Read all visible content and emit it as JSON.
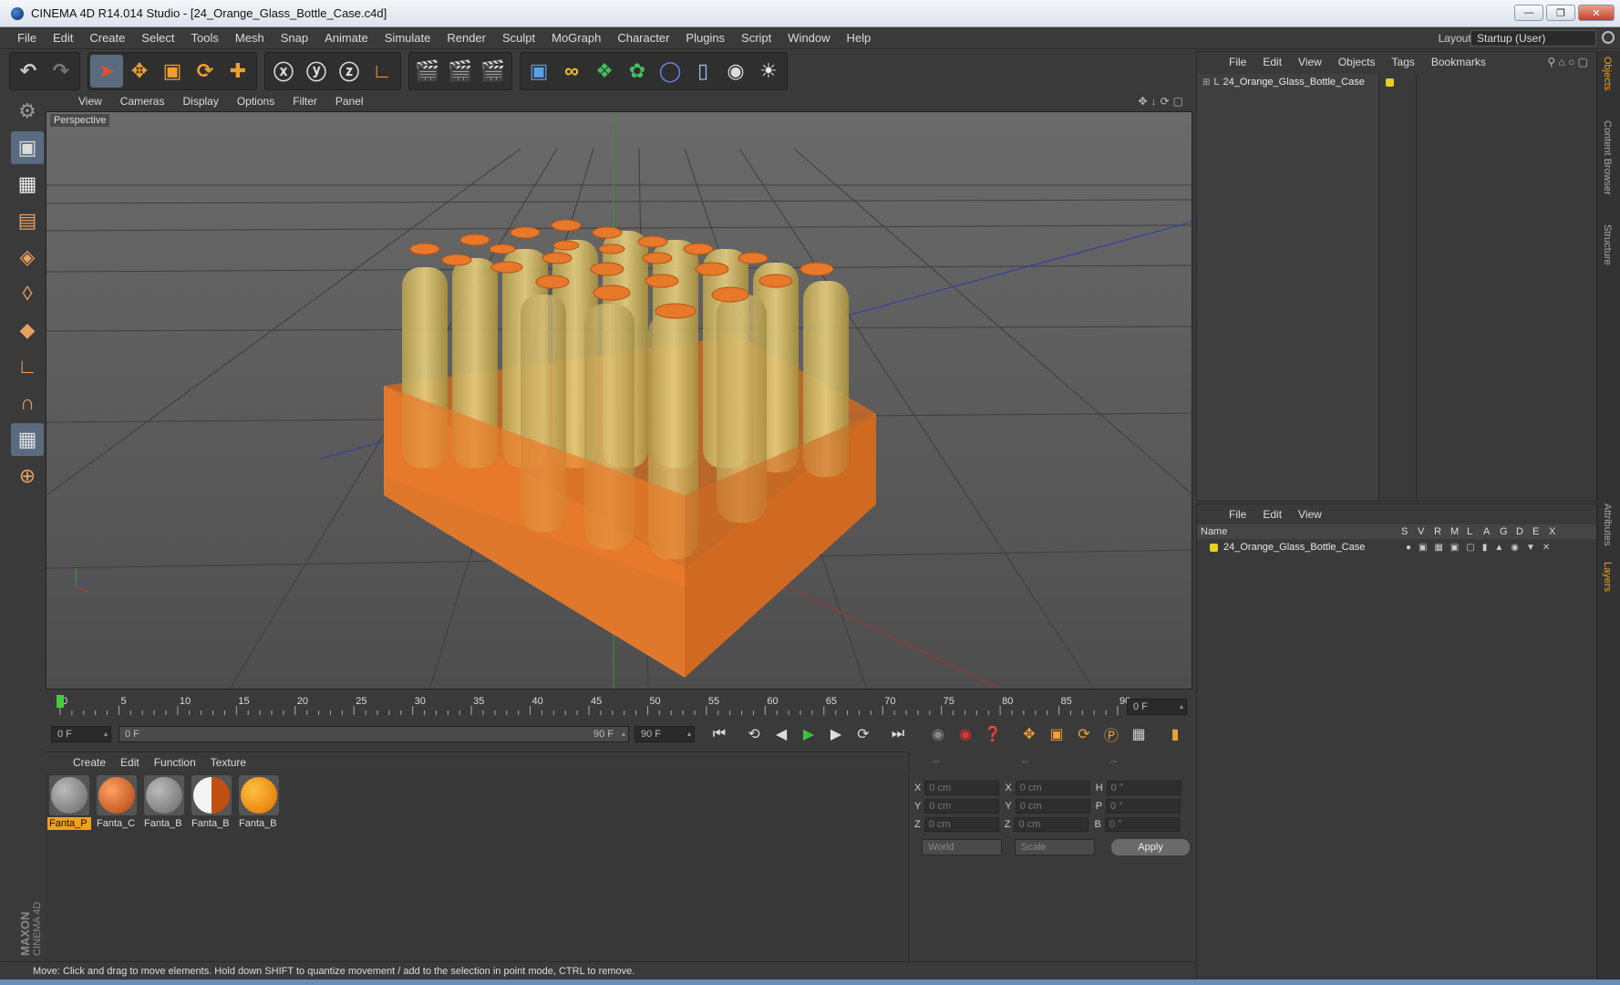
{
  "window": {
    "title": "CINEMA 4D R14.014 Studio - [24_Orange_Glass_Bottle_Case.c4d]"
  },
  "menu": [
    "File",
    "Edit",
    "Create",
    "Select",
    "Tools",
    "Mesh",
    "Snap",
    "Animate",
    "Simulate",
    "Render",
    "Sculpt",
    "MoGraph",
    "Character",
    "Plugins",
    "Script",
    "Window",
    "Help"
  ],
  "layout": {
    "label": "Layout:",
    "value": "Startup (User)"
  },
  "viewport": {
    "menu": [
      "View",
      "Cameras",
      "Display",
      "Options",
      "Filter",
      "Panel"
    ],
    "label": "Perspective"
  },
  "timeline": {
    "ticks": [
      "0",
      "5",
      "10",
      "15",
      "20",
      "25",
      "30",
      "35",
      "40",
      "45",
      "50",
      "55",
      "60",
      "65",
      "70",
      "75",
      "80",
      "85",
      "90"
    ],
    "frame_display": "0 F",
    "current": "0 F",
    "range_start": "0 F",
    "range_end": "90 F",
    "end": "90 F"
  },
  "materials": {
    "menu": [
      "Create",
      "Edit",
      "Function",
      "Texture"
    ],
    "items": [
      {
        "label": "Fanta_P",
        "selected": true,
        "color": "#8a8a8a"
      },
      {
        "label": "Fanta_C",
        "selected": false,
        "color": "#e0661c"
      },
      {
        "label": "Fanta_B",
        "selected": false,
        "color": "#8a8a8a"
      },
      {
        "label": "Fanta_B",
        "selected": false,
        "color": "#f0f0f0"
      },
      {
        "label": "Fanta_B",
        "selected": false,
        "color": "#ff9a10"
      }
    ]
  },
  "attributes": {
    "headers": [
      "--",
      "--",
      "--"
    ],
    "rows": [
      {
        "a_label": "X",
        "a_val": "0 cm",
        "b_label": "X",
        "b_val": "0 cm",
        "c_label": "H",
        "c_val": "0 °"
      },
      {
        "a_label": "Y",
        "a_val": "0 cm",
        "b_label": "Y",
        "b_val": "0 cm",
        "c_label": "P",
        "c_val": "0 °"
      },
      {
        "a_label": "Z",
        "a_val": "0 cm",
        "b_label": "Z",
        "b_val": "0 cm",
        "c_label": "B",
        "c_val": "0 °"
      }
    ],
    "coord_mode": "World",
    "size_mode": "Scale",
    "apply": "Apply"
  },
  "status": "Move: Click and drag to move elements. Hold down SHIFT to quantize movement / add to the selection in point mode, CTRL to remove.",
  "object_manager": {
    "menu": [
      "File",
      "Edit",
      "View",
      "Objects",
      "Tags",
      "Bookmarks"
    ],
    "objects": [
      {
        "name": "24_Orange_Glass_Bottle_Case"
      }
    ]
  },
  "layer_manager": {
    "menu": [
      "File",
      "Edit",
      "View"
    ],
    "columns": [
      "Name",
      "S",
      "V",
      "R",
      "M",
      "L",
      "A",
      "G",
      "D",
      "E",
      "X"
    ],
    "layers": [
      {
        "name": "24_Orange_Glass_Bottle_Case"
      }
    ]
  },
  "side_tabs": [
    "Objects",
    "Content Browser",
    "Structure",
    "Attributes",
    "Layers"
  ],
  "branding": {
    "maxon": "MAXON",
    "product": "CINEMA 4D"
  },
  "colors": {
    "accent": "#f0a020",
    "orange": "#e8782a",
    "layer_yellow": "#e8d020"
  }
}
